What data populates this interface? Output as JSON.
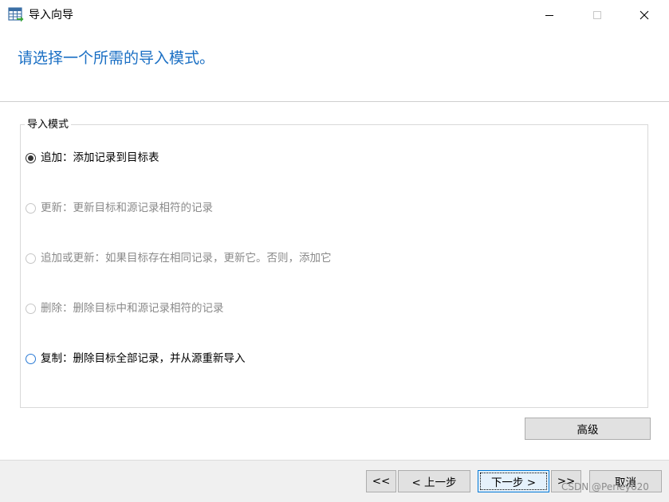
{
  "window": {
    "title": "导入向导",
    "controls": {
      "minimize": "minimize",
      "maximize": "maximize",
      "close": "close"
    }
  },
  "header": {
    "title": "请选择一个所需的导入模式。"
  },
  "import_mode": {
    "legend": "导入模式",
    "options": [
      {
        "label": "追加：添加记录到目标表",
        "selected": true,
        "enabled": true
      },
      {
        "label": "更新：更新目标和源记录相符的记录",
        "selected": false,
        "enabled": false
      },
      {
        "label": "追加或更新：如果目标存在相同记录，更新它。否则，添加它",
        "selected": false,
        "enabled": false
      },
      {
        "label": "删除：删除目标中和源记录相符的记录",
        "selected": false,
        "enabled": false
      },
      {
        "label": "复制：删除目标全部记录，并从源重新导入",
        "selected": false,
        "enabled": true
      }
    ]
  },
  "buttons": {
    "advanced": "高级",
    "first": "<<",
    "prev": "< 上一步",
    "next": "下一步 >",
    "last": ">>",
    "cancel": "取消"
  },
  "watermark": "CSDN @Perley620",
  "colors": {
    "accent": "#1a6fc4",
    "disabled_text": "#8a8a8a",
    "footer_bg": "#f0f0f0",
    "button_bg": "#e1e1e1",
    "focus_border": "#0078d7"
  }
}
